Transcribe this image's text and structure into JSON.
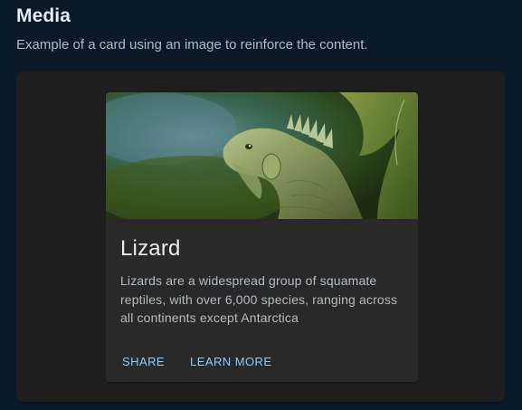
{
  "section": {
    "title": "Media",
    "subtitle": "Example of a card using an image to reinforce the content."
  },
  "card": {
    "media_alt": "green iguana",
    "title": "Lizard",
    "body": "Lizards are a widespread group of squamate reptiles, with over 6,000 species, ranging across all continents except Antarctica",
    "actions": [
      {
        "label": "Share"
      },
      {
        "label": "Learn More"
      }
    ]
  },
  "colors": {
    "page_background": "#0a1929",
    "card_background": "#1e1e1e",
    "action_color": "#90caf9",
    "title_color": "#e7ebf0",
    "body_color": "#b2bac2"
  }
}
